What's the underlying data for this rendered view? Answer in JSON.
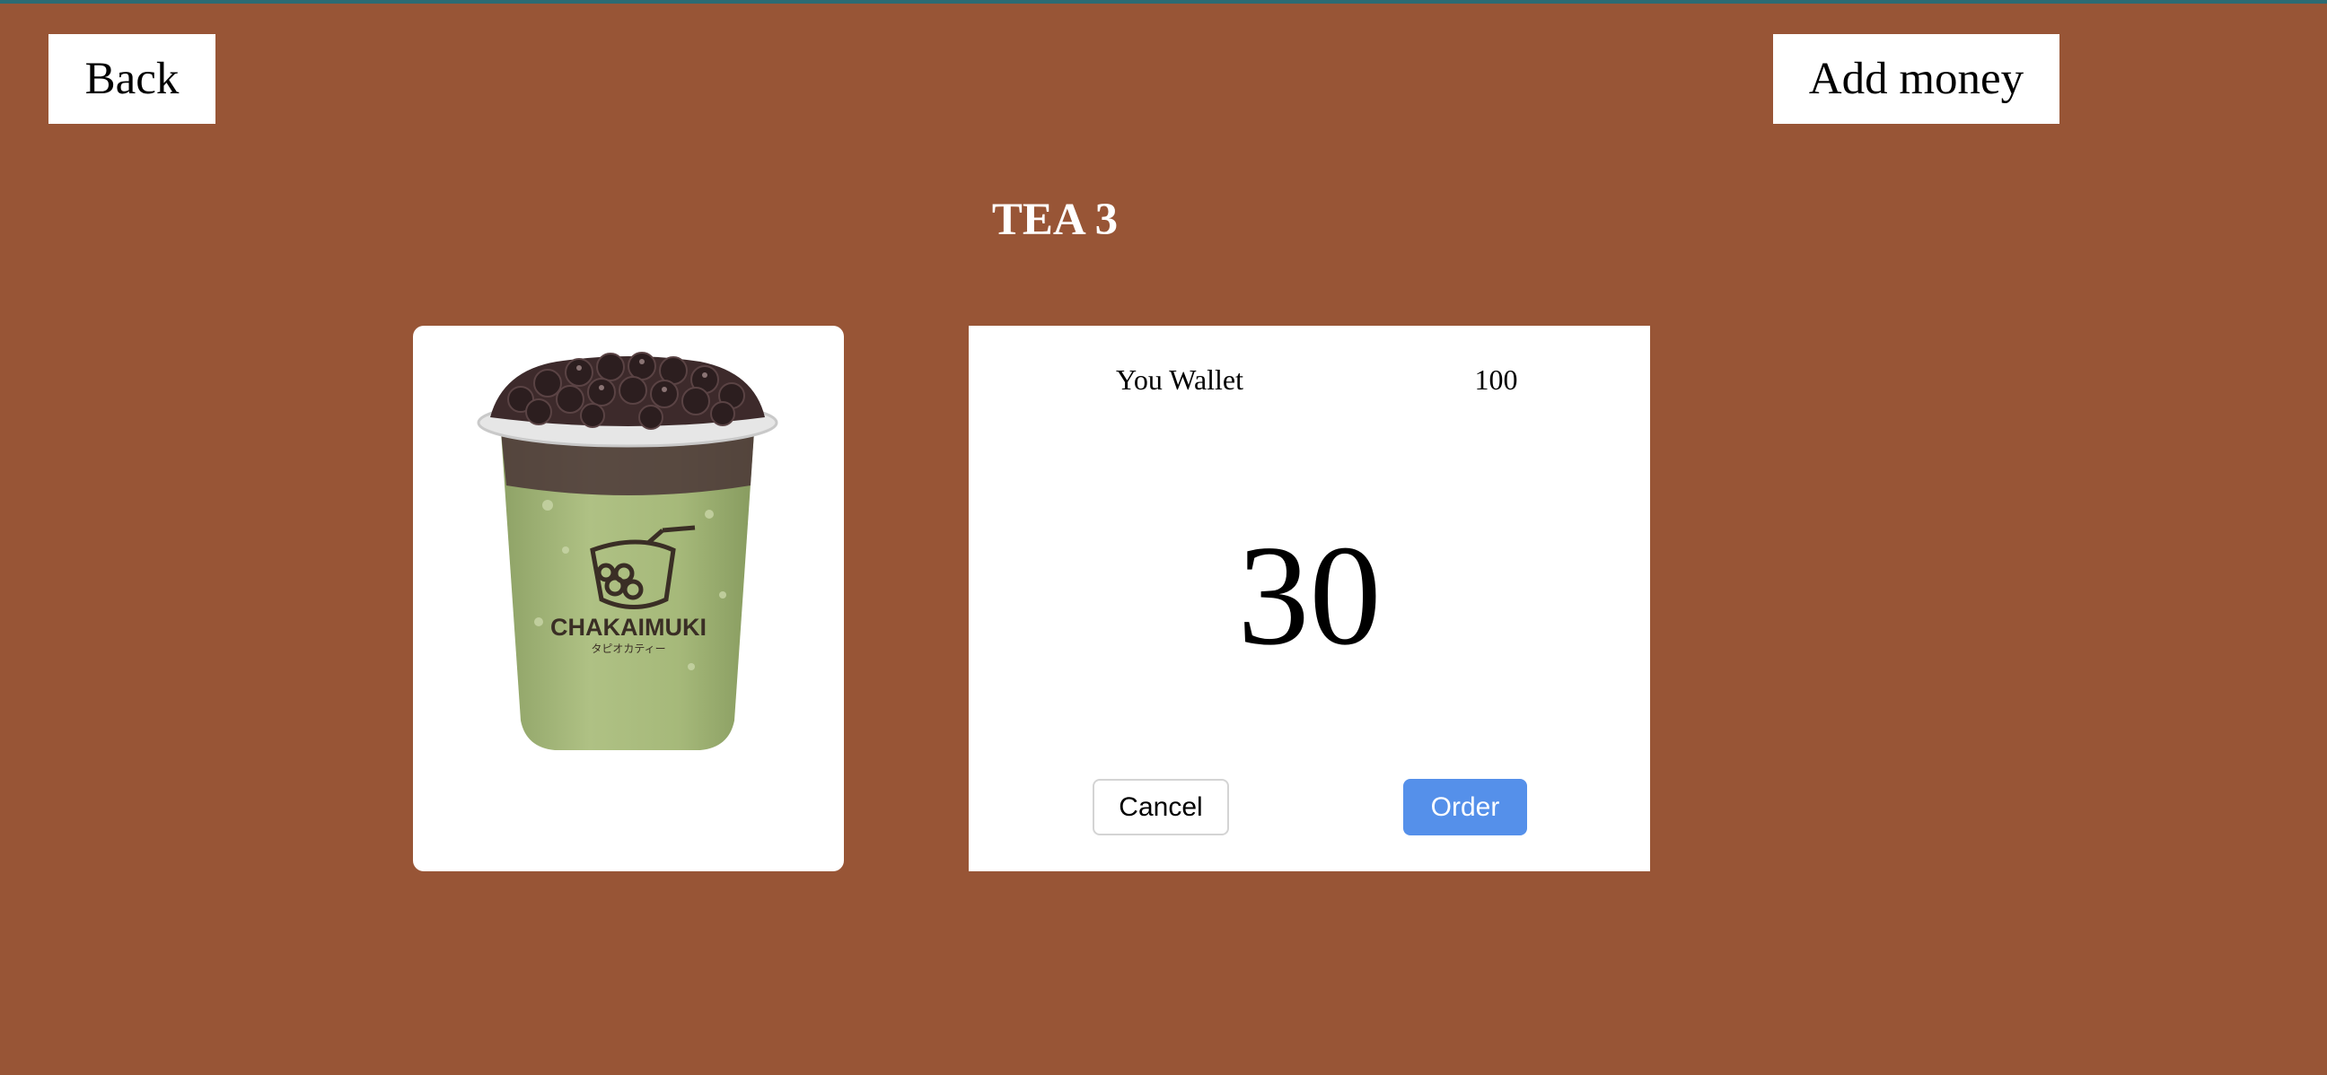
{
  "header": {
    "back_label": "Back",
    "add_money_label": "Add money"
  },
  "product": {
    "title": "TEA 3",
    "image_brand": "CHAKAIMUKI",
    "image_subtext": "タピオカティー"
  },
  "order": {
    "wallet_label": "You Wallet",
    "wallet_value": "100",
    "price": "30",
    "cancel_label": "Cancel",
    "order_label": "Order"
  },
  "colors": {
    "background": "#985536",
    "panel": "#ffffff",
    "order_button": "#5590ea",
    "drink": "#a8bb7c",
    "pearls": "#3d2a2b"
  }
}
